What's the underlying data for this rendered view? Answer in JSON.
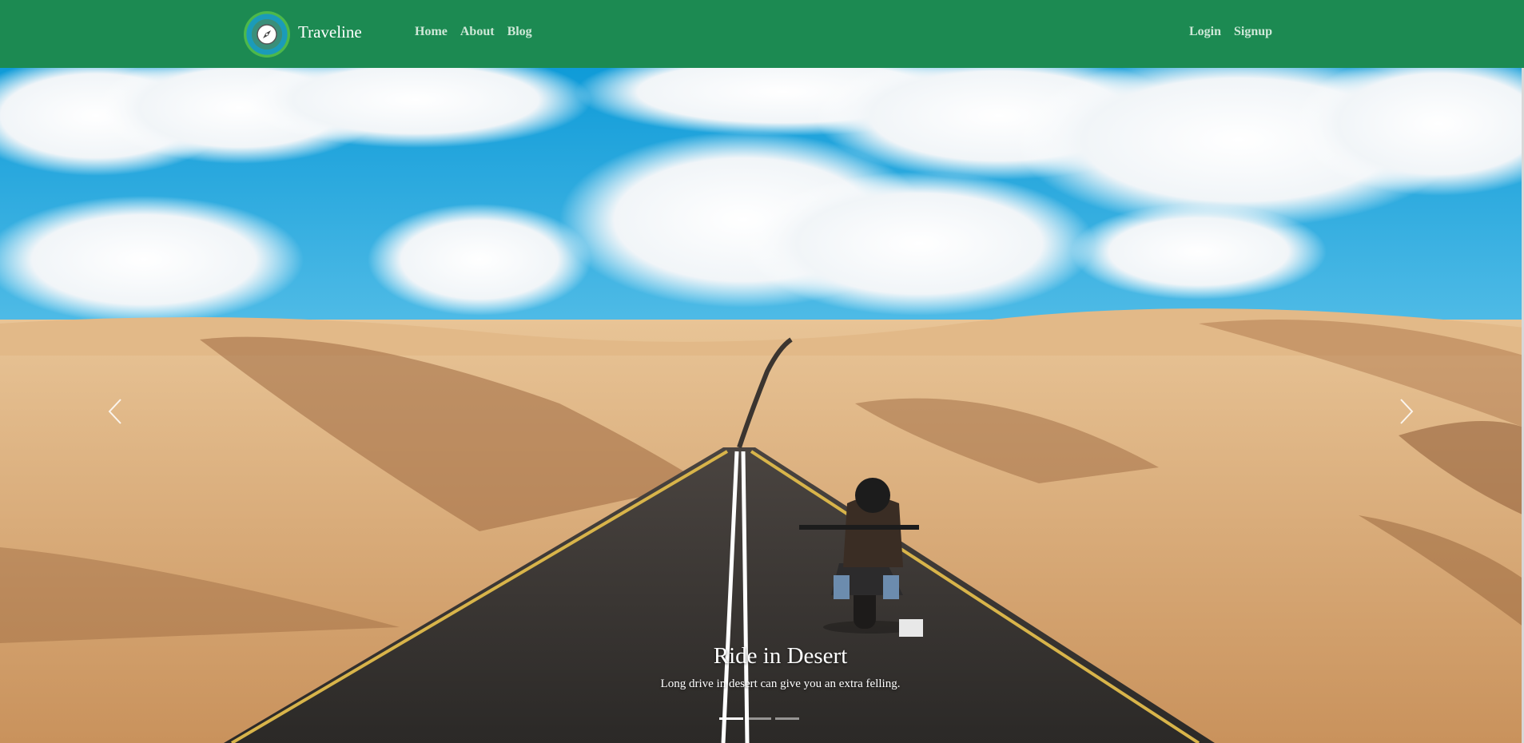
{
  "brand": {
    "name": "Traveline",
    "logo_icon": "compass-icon"
  },
  "nav": {
    "left": [
      {
        "label": "Home"
      },
      {
        "label": "About"
      },
      {
        "label": "Blog"
      }
    ],
    "right": [
      {
        "label": "Login"
      },
      {
        "label": "Signup"
      }
    ]
  },
  "carousel": {
    "prev_icon": "chevron-left-icon",
    "next_icon": "chevron-right-icon",
    "slide": {
      "title": "Ride in Desert",
      "text": "Long drive in desert can give you an extra felling."
    },
    "slide_count": 3,
    "active_index": 0
  },
  "colors": {
    "navbar": "#1c8a52",
    "nav_link": "#cfe8d8",
    "sky": "#1aa3dc",
    "sand": "#d8aa73"
  }
}
